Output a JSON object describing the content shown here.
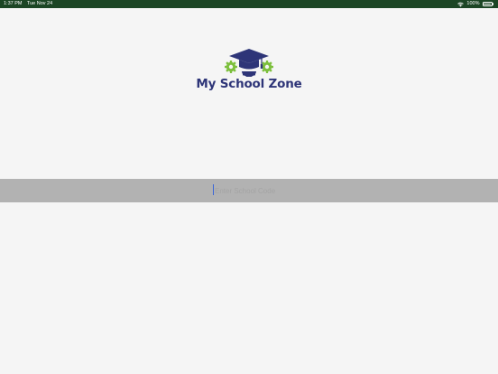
{
  "status_bar": {
    "time": "1:37 PM",
    "date": "Tue Nov 24",
    "battery_percent": "100%",
    "wifi_icon": "wifi-icon",
    "battery_icon": "battery-icon",
    "background_color": "#1c4625"
  },
  "logo": {
    "text": "My School Zone",
    "icon": "graduation-cap-with-gears-icon",
    "text_color": "#2e3578",
    "cap_color": "#2e3578",
    "gear_color": "#7cbf3c"
  },
  "code_entry": {
    "placeholder": "Enter School Code",
    "value": ""
  }
}
